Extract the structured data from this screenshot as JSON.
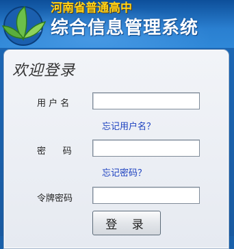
{
  "header": {
    "school_name": "河南省普通高中",
    "system_name": "综合信息管理系统"
  },
  "login": {
    "welcome": "欢迎登录",
    "username_label": "用 户 名",
    "username_value": "",
    "forgot_username": "忘记用户名？",
    "password_label": "密      码",
    "password_value": "",
    "forgot_password": "忘记密码？",
    "token_label": "令牌密码",
    "token_value": "",
    "login_button": "登 录"
  },
  "colors": {
    "header_blue": "#2a7fd0",
    "school_name_yellow": "#ffd21a",
    "link_blue": "#1a3fbf"
  }
}
